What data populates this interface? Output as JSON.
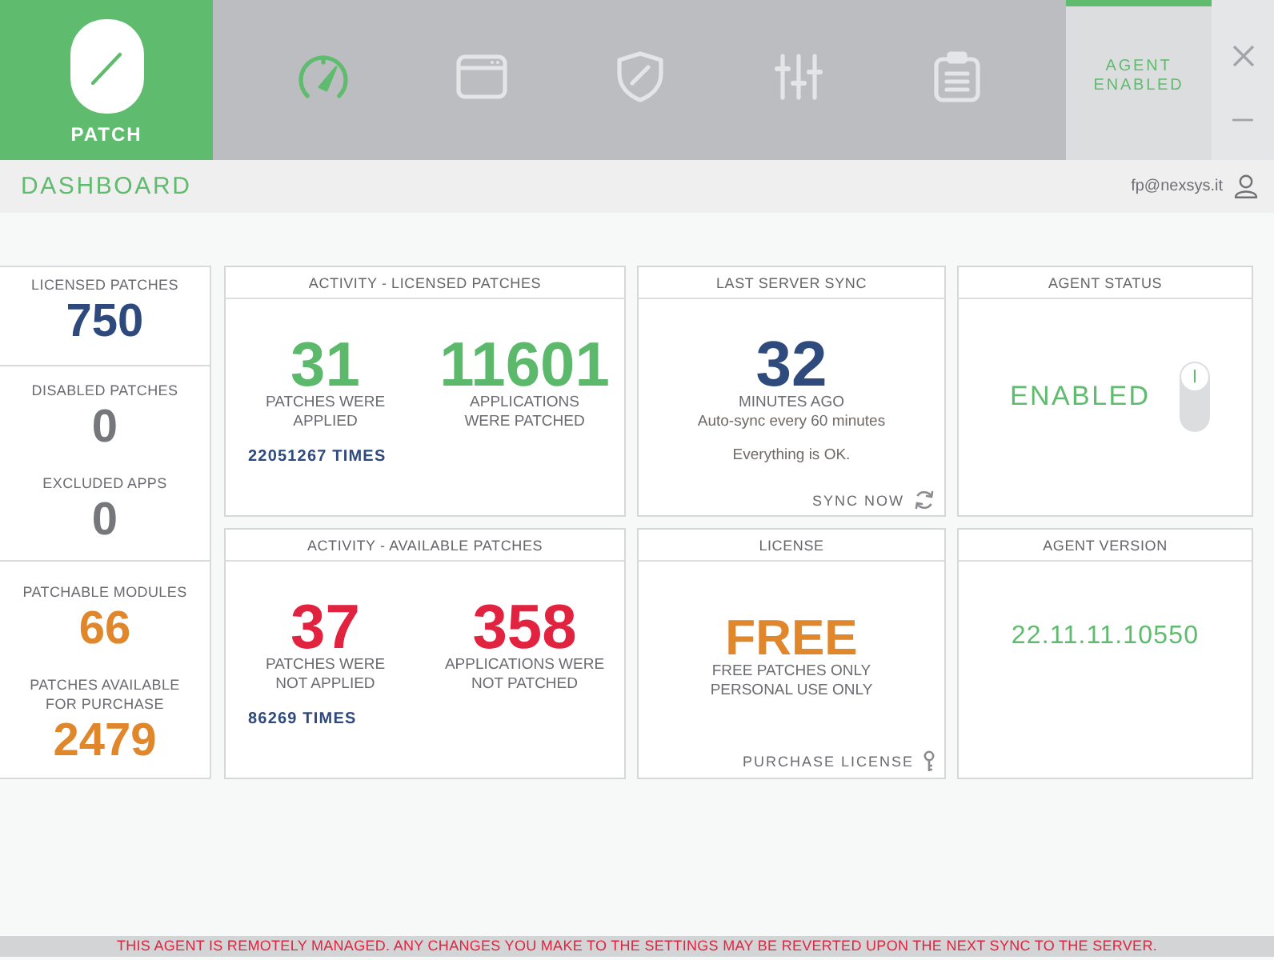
{
  "app": {
    "logo_label": "PATCH"
  },
  "nav": [
    {
      "kind": "gauge",
      "selected": true
    },
    {
      "kind": "window",
      "selected": false
    },
    {
      "kind": "shield",
      "selected": false
    },
    {
      "kind": "sliders",
      "selected": false
    },
    {
      "kind": "clipboard",
      "selected": false
    }
  ],
  "agent_badge": {
    "label": "AGENT ENABLED"
  },
  "page_header": {
    "title": "DASHBOARD",
    "user": "fp@nexsys.it"
  },
  "summary": [
    {
      "color": "#2e4a7d",
      "items": [
        {
          "label": "LICENSED PATCHES",
          "value": "750"
        }
      ]
    },
    {
      "color": "#76777b",
      "items": [
        {
          "label": "DISABLED PATCHES",
          "value": "0"
        },
        {
          "label": "EXCLUDED APPS",
          "value": "0"
        }
      ]
    },
    {
      "color": "#e0862b",
      "items": [
        {
          "label": "PATCHABLE MODULES",
          "value": "66"
        },
        {
          "label": "PATCHES AVAILABLE FOR PURCHASE",
          "value": "2479"
        }
      ]
    }
  ],
  "cards": [
    {
      "kind": "activity",
      "title": "ACTIVITY - LICENSED PATCHES",
      "color": "#5cb96b",
      "stats": [
        {
          "value": "31",
          "label_lines": [
            "PATCHES WERE",
            "APPLIED"
          ]
        },
        {
          "value": "11601",
          "label_lines": [
            "APPLICATIONS",
            "WERE PATCHED"
          ]
        }
      ],
      "times": "22051267 TIMES"
    },
    {
      "kind": "sync",
      "title": "LAST SERVER SYNC",
      "value": "32",
      "unit": "MINUTES AGO",
      "note": "Auto-sync every 60 minutes",
      "status": "Everything is OK.",
      "action": "SYNC NOW"
    },
    {
      "kind": "status",
      "title": "AGENT STATUS",
      "value": "ENABLED",
      "on": true
    },
    {
      "kind": "activity",
      "title": "ACTIVITY - AVAILABLE PATCHES",
      "color": "#e2233f",
      "stats": [
        {
          "value": "37",
          "label_lines": [
            "PATCHES WERE",
            "NOT APPLIED"
          ]
        },
        {
          "value": "358",
          "label_lines": [
            "APPLICATIONS WERE",
            "NOT PATCHED"
          ]
        }
      ],
      "times": "86269 TIMES"
    },
    {
      "kind": "license",
      "title": "LICENSE",
      "value": "FREE",
      "lines": [
        "FREE PATCHES ONLY",
        "PERSONAL USE ONLY"
      ],
      "action": "PURCHASE LICENSE"
    },
    {
      "kind": "version",
      "title": "AGENT VERSION",
      "value": "22.11.11.10550"
    }
  ],
  "status_bar": "THIS AGENT IS REMOTELY MANAGED. ANY CHANGES YOU MAKE TO THE SETTINGS MAY BE REVERTED UPON THE NEXT SYNC TO THE SERVER."
}
